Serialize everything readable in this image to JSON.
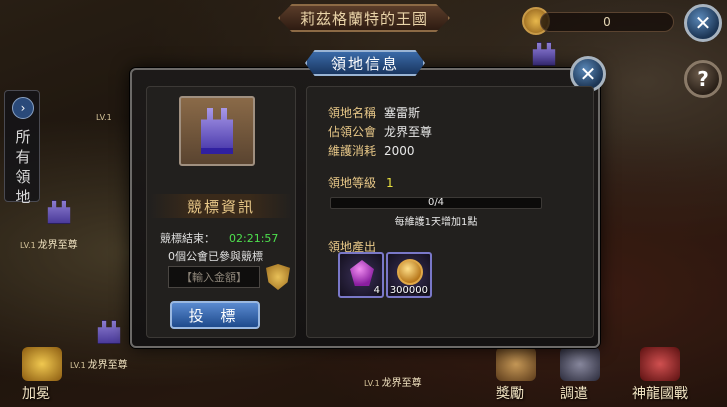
{
  "kingdom_title": "莉茲格蘭特的王國",
  "resource_value": "0",
  "side_tab": {
    "label": "所有領地"
  },
  "map_markers": [
    {
      "level": "LV.1",
      "name": ""
    },
    {
      "level": "LV.1",
      "name": "龙界至尊"
    },
    {
      "level": "LV.1",
      "name": "龙界至尊"
    },
    {
      "level": "LV.1",
      "name": "龙界至尊"
    }
  ],
  "bottom_nav": [
    "加冕",
    "獎勵",
    "調遣",
    "神龍國戰"
  ],
  "modal": {
    "title": "領地信息",
    "territory_name_label": "領地名稱",
    "territory_name_value": "塞雷斯",
    "guild_label": "佔領公會",
    "guild_value": "龙界至尊",
    "maintenance_label": "維護消耗",
    "maintenance_value": "2000",
    "level_label": "領地等級",
    "level_value": "1",
    "progress": {
      "text": "0/4",
      "fraction": 0.0
    },
    "progress_note": "每維護1天增加1點",
    "output_title": "領地產出",
    "items": [
      {
        "icon": "purple-gem-icon",
        "quantity": "4"
      },
      {
        "icon": "gold-coin-icon",
        "quantity": "300000"
      }
    ],
    "bid": {
      "header": "競標資訊",
      "end_label": "競標結束：",
      "end_time": "02:21:57",
      "participants": "0個公會已參與競標",
      "input_placeholder": "【輸入金額】",
      "button_label": "投 標"
    }
  },
  "colors": {
    "accent_gold": "#e8c888",
    "timer_green": "#4ee04e",
    "button_blue": "#1e4a8c"
  }
}
